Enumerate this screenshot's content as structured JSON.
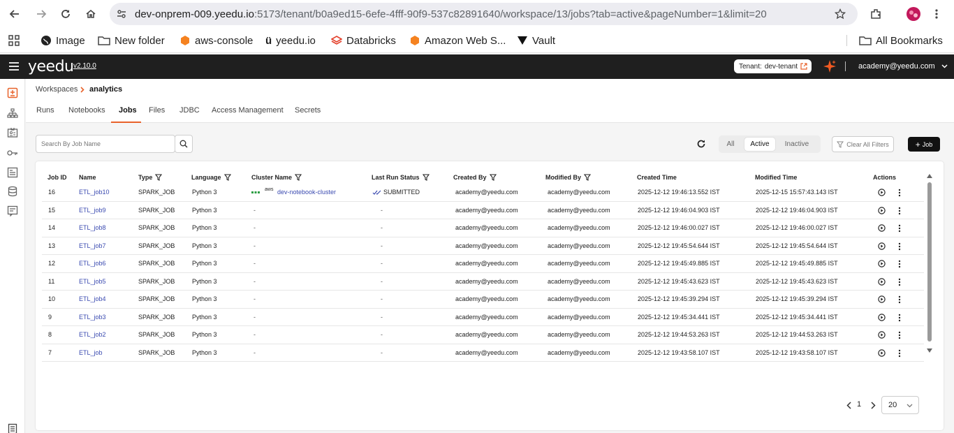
{
  "browser": {
    "url_host": "dev-onprem-009.yeedu.io",
    "url_rest": ":5173/tenant/b0a9ed15-6efe-4fff-90f9-537c82891640/workspace/13/jobs?tab=active&pageNumber=1&limit=20",
    "bookmarks": [
      "Image",
      "New folder",
      "aws-console",
      "yeedu.io",
      "Databricks",
      "Amazon Web S...",
      "Vault"
    ],
    "all_bookmarks": "All Bookmarks"
  },
  "header": {
    "brand": "yeedu",
    "version": "v2.10.0",
    "tenant_label": "Tenant:",
    "tenant_name": "dev-tenant",
    "user": "academy@yeedu.com"
  },
  "breadcrumb": {
    "root": "Workspaces",
    "current": "analytics"
  },
  "tabs": [
    "Runs",
    "Notebooks",
    "Jobs",
    "Files",
    "JDBC",
    "Access Management",
    "Secrets"
  ],
  "toolbar": {
    "search_placeholder": "Search By Job Name",
    "filters": [
      "All",
      "Active",
      "Inactive"
    ],
    "clear_filters": "Clear All Filters",
    "add_job": "Job"
  },
  "columns": [
    "Job ID",
    "Name",
    "Type",
    "Language",
    "Cluster Name",
    "Last Run Status",
    "Created By",
    "Modified By",
    "Created Time",
    "Modified Time",
    "Actions"
  ],
  "rows": [
    {
      "id": "16",
      "name": "ETL_job10",
      "type": "SPARK_JOB",
      "language": "Python 3",
      "cluster": "dev-notebook-cluster",
      "cluster_provider": "aws",
      "status": "SUBMITTED",
      "created_by": "academy@yeedu.com",
      "modified_by": "academy@yeedu.com",
      "created": "2025-12-12 19:46:13.552 IST",
      "modified": "2025-12-15 15:57:43.143 IST"
    },
    {
      "id": "15",
      "name": "ETL_job9",
      "type": "SPARK_JOB",
      "language": "Python 3",
      "cluster": "-",
      "status": "-",
      "created_by": "academy@yeedu.com",
      "modified_by": "academy@yeedu.com",
      "created": "2025-12-12 19:46:04.903 IST",
      "modified": "2025-12-12 19:46:04.903 IST"
    },
    {
      "id": "14",
      "name": "ETL_job8",
      "type": "SPARK_JOB",
      "language": "Python 3",
      "cluster": "-",
      "status": "-",
      "created_by": "academy@yeedu.com",
      "modified_by": "academy@yeedu.com",
      "created": "2025-12-12 19:46:00.027 IST",
      "modified": "2025-12-12 19:46:00.027 IST"
    },
    {
      "id": "13",
      "name": "ETL_job7",
      "type": "SPARK_JOB",
      "language": "Python 3",
      "cluster": "-",
      "status": "-",
      "created_by": "academy@yeedu.com",
      "modified_by": "academy@yeedu.com",
      "created": "2025-12-12 19:45:54.644 IST",
      "modified": "2025-12-12 19:45:54.644 IST"
    },
    {
      "id": "12",
      "name": "ETL_job6",
      "type": "SPARK_JOB",
      "language": "Python 3",
      "cluster": "-",
      "status": "-",
      "created_by": "academy@yeedu.com",
      "modified_by": "academy@yeedu.com",
      "created": "2025-12-12 19:45:49.885 IST",
      "modified": "2025-12-12 19:45:49.885 IST"
    },
    {
      "id": "11",
      "name": "ETL_job5",
      "type": "SPARK_JOB",
      "language": "Python 3",
      "cluster": "-",
      "status": "-",
      "created_by": "academy@yeedu.com",
      "modified_by": "academy@yeedu.com",
      "created": "2025-12-12 19:45:43.623 IST",
      "modified": "2025-12-12 19:45:43.623 IST"
    },
    {
      "id": "10",
      "name": "ETL_job4",
      "type": "SPARK_JOB",
      "language": "Python 3",
      "cluster": "-",
      "status": "-",
      "created_by": "academy@yeedu.com",
      "modified_by": "academy@yeedu.com",
      "created": "2025-12-12 19:45:39.294 IST",
      "modified": "2025-12-12 19:45:39.294 IST"
    },
    {
      "id": "9",
      "name": "ETL_job3",
      "type": "SPARK_JOB",
      "language": "Python 3",
      "cluster": "-",
      "status": "-",
      "created_by": "academy@yeedu.com",
      "modified_by": "academy@yeedu.com",
      "created": "2025-12-12 19:45:34.441 IST",
      "modified": "2025-12-12 19:45:34.441 IST"
    },
    {
      "id": "8",
      "name": "ETL_job2",
      "type": "SPARK_JOB",
      "language": "Python 3",
      "cluster": "-",
      "status": "-",
      "created_by": "academy@yeedu.com",
      "modified_by": "academy@yeedu.com",
      "created": "2025-12-12 19:44:53.263 IST",
      "modified": "2025-12-12 19:44:53.263 IST"
    },
    {
      "id": "7",
      "name": "ETL_job",
      "type": "SPARK_JOB",
      "language": "Python 3",
      "cluster": "-",
      "status": "-",
      "created_by": "academy@yeedu.com",
      "modified_by": "academy@yeedu.com",
      "created": "2025-12-12 19:43:58.107 IST",
      "modified": "2025-12-12 19:43:58.107 IST"
    }
  ],
  "pagination": {
    "page": "1",
    "page_size": "20"
  },
  "colors": {
    "accent": "#e8622a",
    "link": "#3a4ab0",
    "header_bg": "#1f1f1f"
  }
}
